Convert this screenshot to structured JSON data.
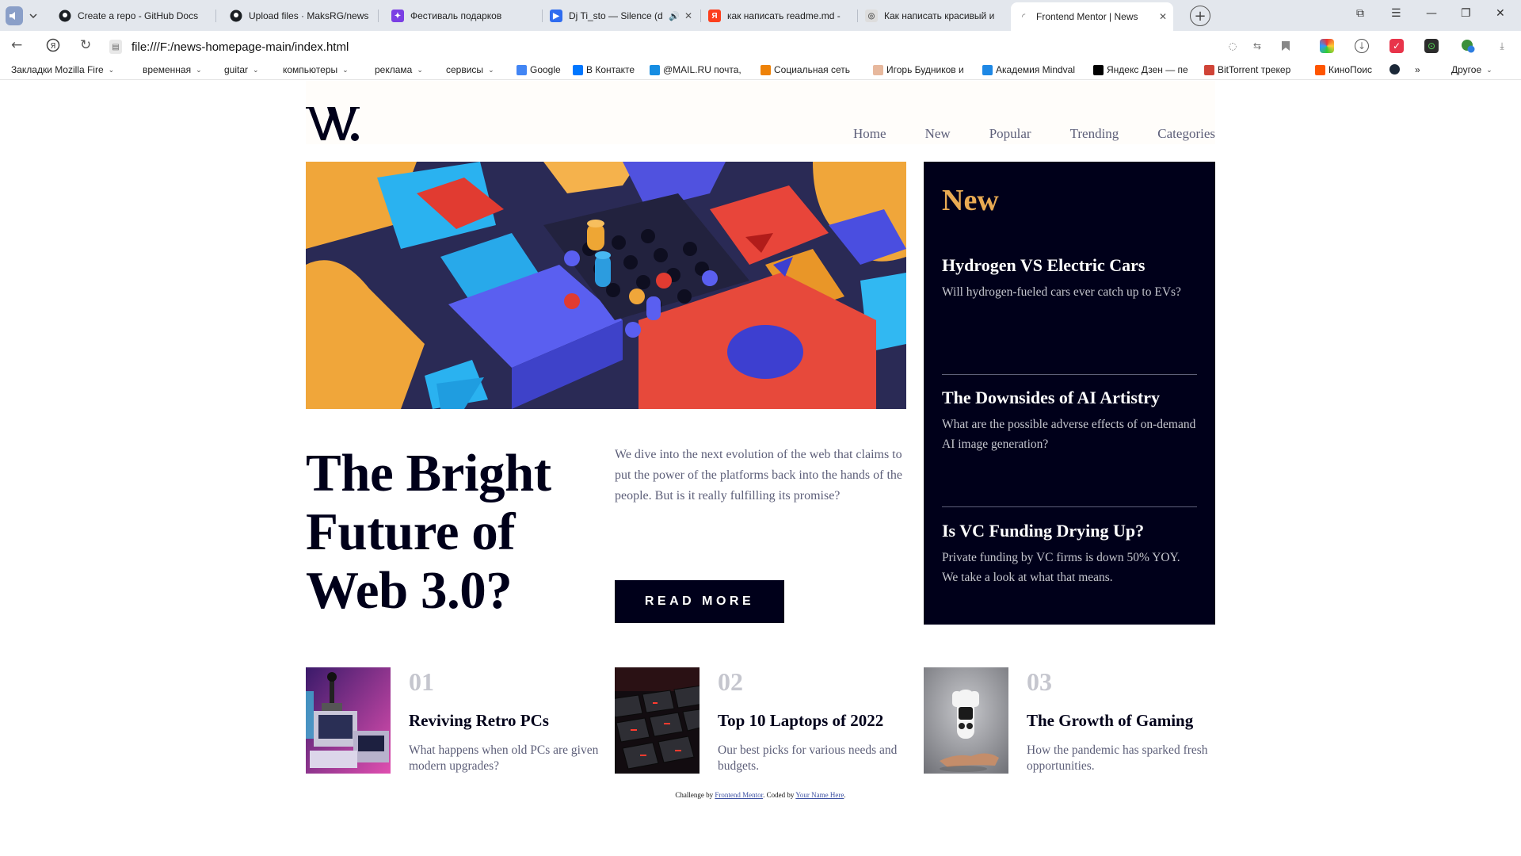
{
  "browser": {
    "tabs": [
      {
        "label": "Create a repo - GitHub Docs",
        "icon": "github-icon",
        "color": "#1b1f23"
      },
      {
        "label": "Upload files · MaksRG/news",
        "icon": "github-icon",
        "color": "#1b1f23"
      },
      {
        "label": "Фестиваль подарков",
        "icon": "gift-icon",
        "color": "#7b3fe4"
      },
      {
        "label": "Dj Ti_sto — Silence (d",
        "icon": "play-icon",
        "color": "#2f6cf0"
      },
      {
        "label": "как написать readme.md -",
        "icon": "yandex-icon",
        "color": "#fc3f1d"
      },
      {
        "label": "Как написать красивый и",
        "icon": "article-icon",
        "color": "#888888"
      },
      {
        "label": "Frontend Mentor | News",
        "icon": "loading-icon",
        "color": "#aaaaaa"
      }
    ],
    "url": "file:///F:/news-homepage-main/index.html",
    "bookmarks": [
      {
        "label": "Закладки Mozilla Fire",
        "dropdown": true,
        "color": ""
      },
      {
        "label": "временная",
        "dropdown": true,
        "color": ""
      },
      {
        "label": "guitar",
        "dropdown": true,
        "color": ""
      },
      {
        "label": "компьютеры",
        "dropdown": true,
        "color": ""
      },
      {
        "label": "реклама",
        "dropdown": true,
        "color": ""
      },
      {
        "label": "сервисы",
        "dropdown": true,
        "color": ""
      },
      {
        "label": "Google",
        "dropdown": false,
        "color": "#4285f4"
      },
      {
        "label": "В Контакте",
        "dropdown": false,
        "color": "#0077ff"
      },
      {
        "label": "@MAIL.RU почта,",
        "dropdown": false,
        "color": "#168de2"
      },
      {
        "label": "Социальная сеть",
        "dropdown": false,
        "color": "#ee8208"
      },
      {
        "label": "Игорь Будников и",
        "dropdown": false,
        "color": "#e7b89d"
      },
      {
        "label": "Академия Mindval",
        "dropdown": false,
        "color": "#1e88e5"
      },
      {
        "label": "Яндекс Дзен — пе",
        "dropdown": false,
        "color": "#000000"
      },
      {
        "label": "BitTorrent трекер",
        "dropdown": false,
        "color": "#d04437"
      },
      {
        "label": "КиноПоис",
        "dropdown": false,
        "color": "#ff5500"
      }
    ],
    "other_bookmarks": "Другое",
    "more_chevron": "»"
  },
  "site": {
    "logo": "W.",
    "nav": [
      "Home",
      "New",
      "Popular",
      "Trending",
      "Categories"
    ],
    "hero": {
      "headline": "The Bright Future of Web 3.0?",
      "lede": "We dive into the next evolution of the web that claims to put the power of the platforms back into the hands of the people. But is it really fulfilling its promise?",
      "button": "READ MORE"
    },
    "new_panel": {
      "title": "New",
      "items": [
        {
          "title": "Hydrogen VS Electric Cars",
          "text": "Will hydrogen-fueled cars ever catch up to EVs?"
        },
        {
          "title": "The Downsides of AI Artistry",
          "text": "What are the possible adverse effects of on-demand AI image generation?"
        },
        {
          "title": "Is VC Funding Drying Up?",
          "text": "Private funding by VC firms is down 50% YOY. We take a look at what that means."
        }
      ]
    },
    "cards": [
      {
        "num": "01",
        "title": "Reviving Retro PCs",
        "text": "What happens when old PCs are given modern upgrades?"
      },
      {
        "num": "02",
        "title": "Top 10 Laptops of 2022",
        "text": "Our best picks for various needs and budgets."
      },
      {
        "num": "03",
        "title": "The Growth of Gaming",
        "text": "How the pandemic has sparked fresh opportunities."
      }
    ],
    "attribution": {
      "prefix": "Challenge by",
      "link1": "Frontend Mentor",
      "middle": ". Coded by",
      "link2": "Your Name Here",
      "suffix": "."
    },
    "colors": {
      "soft_orange": "#e9ab53",
      "soft_red": "#f15d51",
      "off_white": "#fffdfa",
      "grayish_blue": "#c5c6ce",
      "dark_grayish_blue": "#5d5f79",
      "very_dark_blue": "#00001a"
    }
  }
}
